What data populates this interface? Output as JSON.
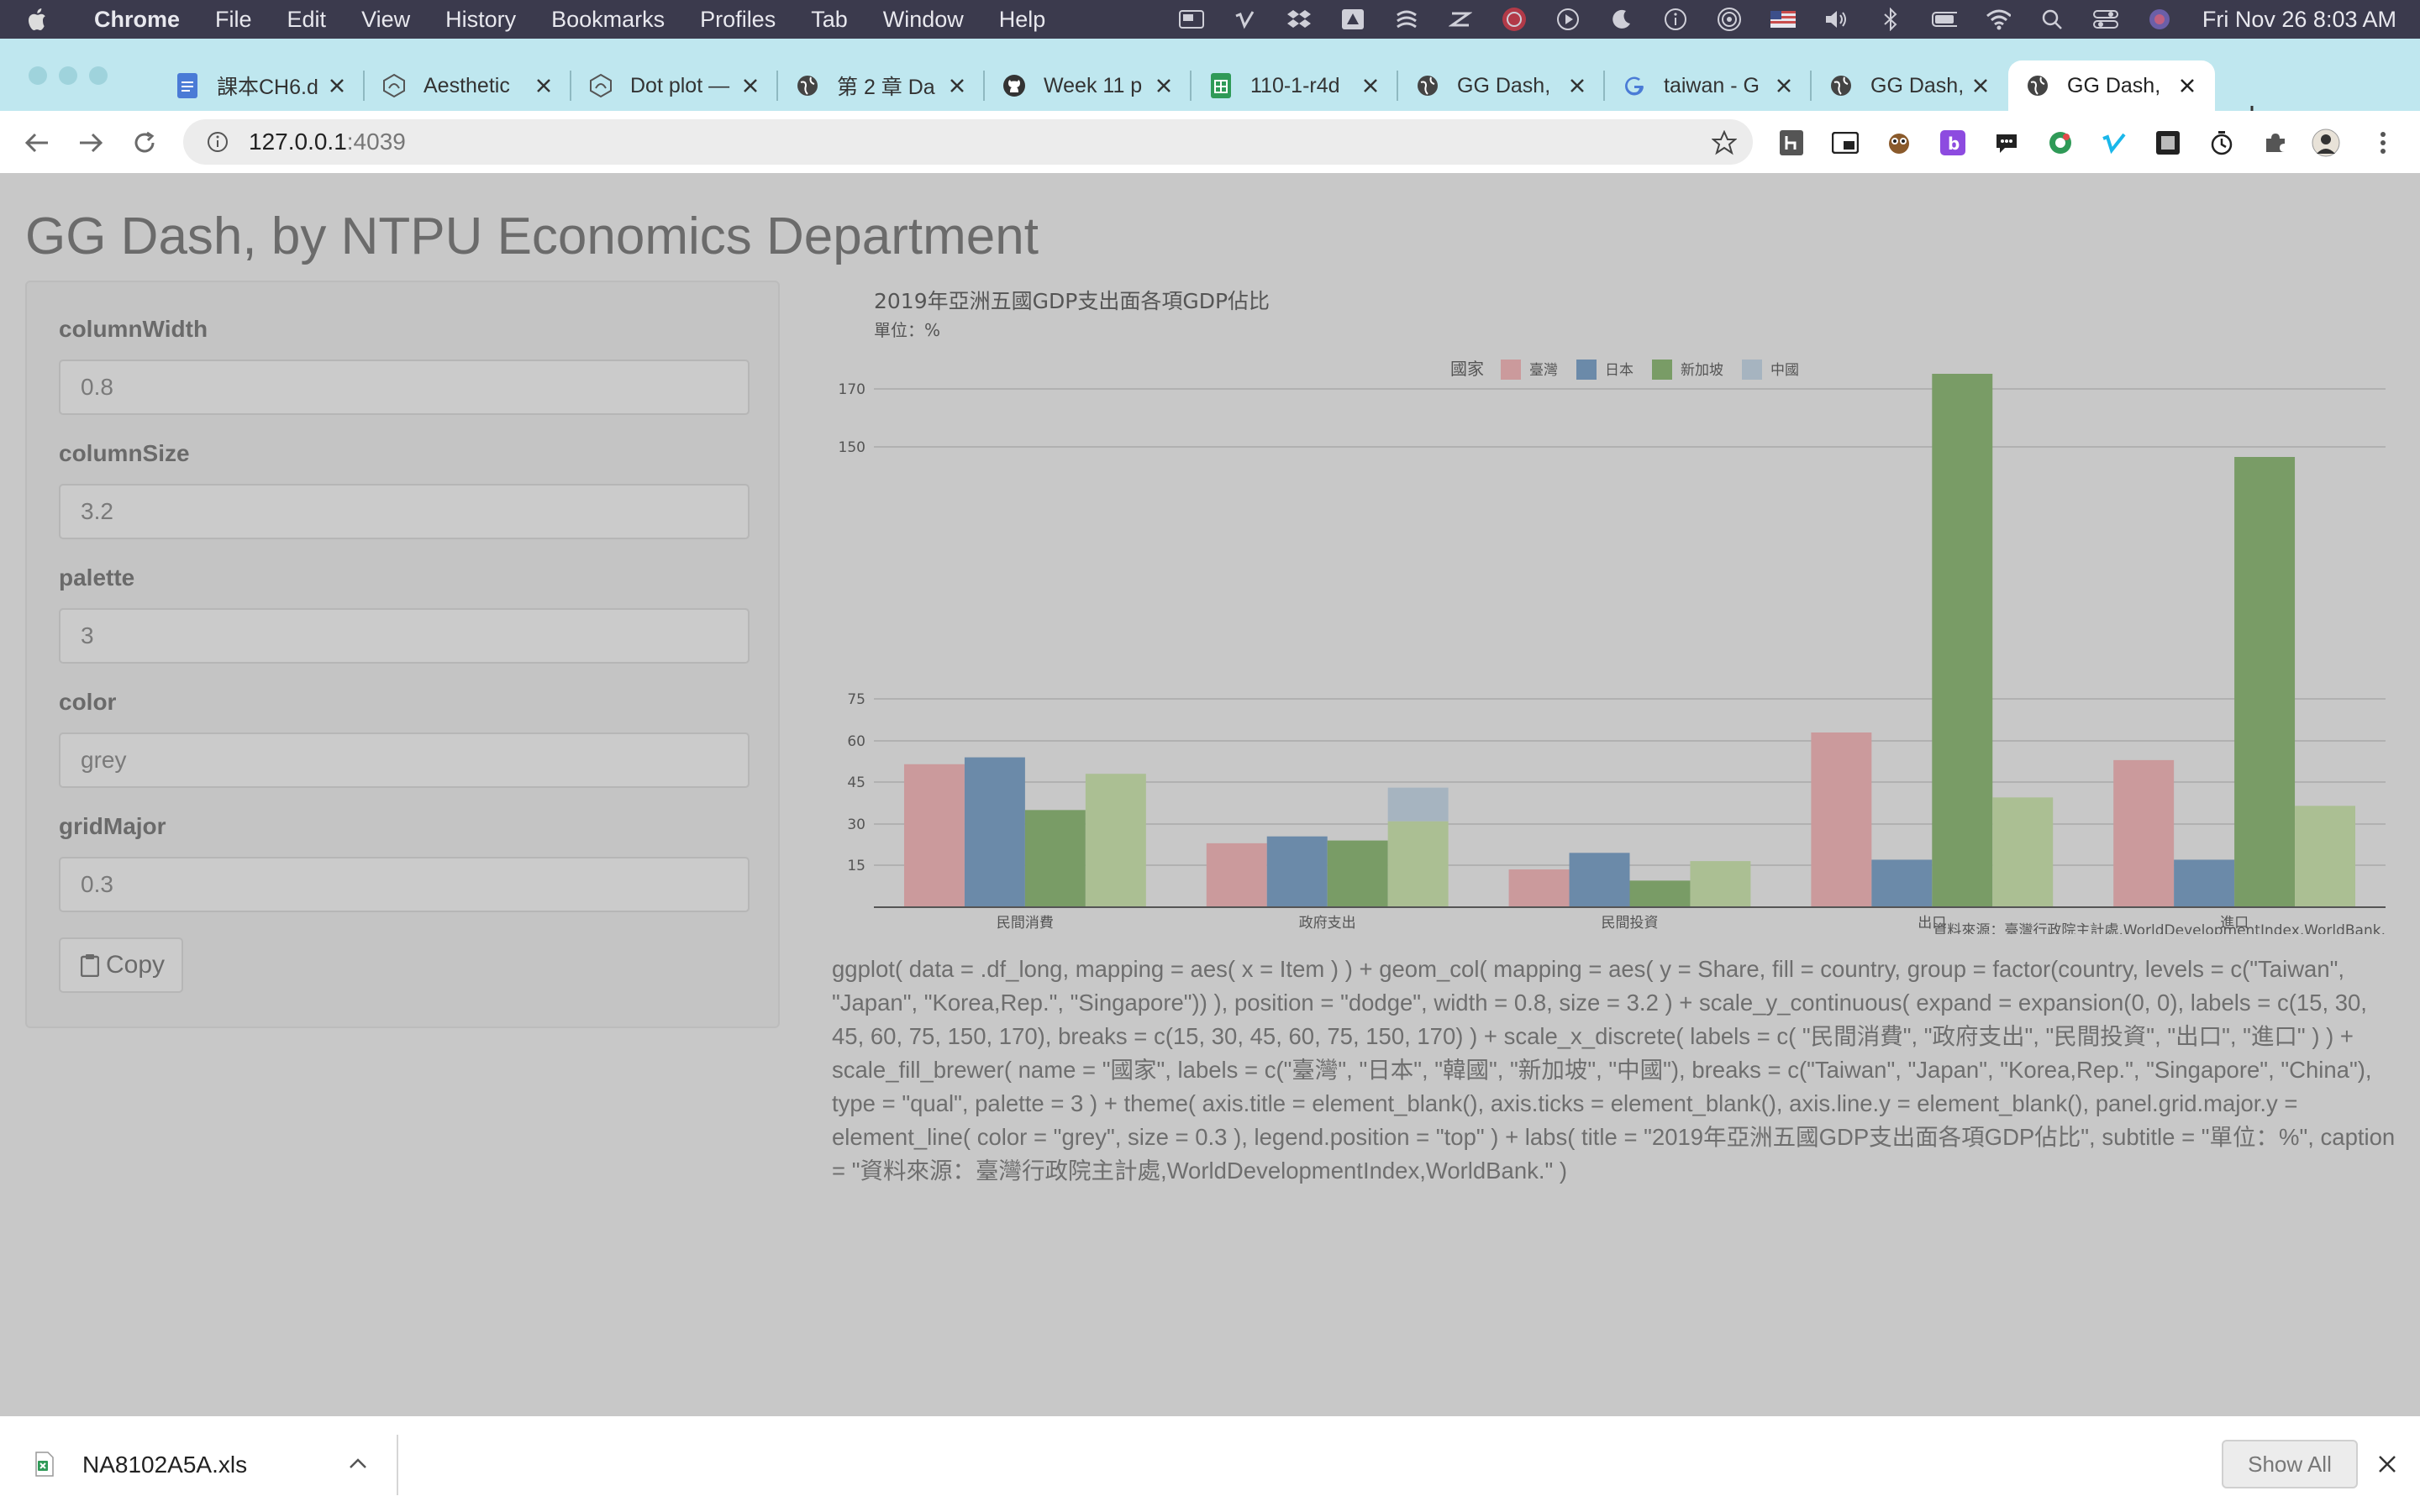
{
  "menubar": {
    "app": "Chrome",
    "items": [
      "File",
      "Edit",
      "View",
      "History",
      "Bookmarks",
      "Profiles",
      "Tab",
      "Window",
      "Help"
    ],
    "clock": "Fri Nov 26  8:03 AM",
    "tray_icons": [
      "window-icon",
      "vimeo-icon",
      "dropbox-icon",
      "drive-icon",
      "app-icon",
      "app-icon",
      "app-icon",
      "play-icon",
      "moon-icon",
      "info-icon",
      "airdrop-icon",
      "flag-icon",
      "volume-icon",
      "bluetooth-icon",
      "battery-icon",
      "wifi-icon",
      "search-icon",
      "control-center-icon",
      "siri-icon"
    ]
  },
  "tabs": [
    {
      "title": "課本CH6.d",
      "icon": "docs-icon"
    },
    {
      "title": "Aesthetic",
      "icon": "ggplot-icon"
    },
    {
      "title": "Dot plot —",
      "icon": "ggplot-icon"
    },
    {
      "title": "第 2 章 Da",
      "icon": "globe-icon"
    },
    {
      "title": "Week 11 p",
      "icon": "github-icon"
    },
    {
      "title": "110-1-r4d",
      "icon": "sheets-icon"
    },
    {
      "title": "GG Dash,",
      "icon": "globe-icon"
    },
    {
      "title": "taiwan - G",
      "icon": "google-icon"
    },
    {
      "title": "GG Dash,",
      "icon": "globe-icon"
    },
    {
      "title": "GG Dash,",
      "icon": "globe-icon"
    }
  ],
  "active_tab": 9,
  "address": {
    "host": "127.0.0.1",
    "port": ":4039"
  },
  "page": {
    "title": "GG Dash, by NTPU Economics Department",
    "fields": [
      {
        "label": "columnWidth",
        "value": "0.8"
      },
      {
        "label": "columnSize",
        "value": "3.2"
      },
      {
        "label": "palette",
        "value": "3"
      },
      {
        "label": "color",
        "value": "grey"
      },
      {
        "label": "gridMajor",
        "value": "0.3"
      }
    ],
    "copy_label": "Copy",
    "code": "ggplot( data = .df_long, mapping = aes( x = Item ) ) + geom_col( mapping = aes( y = Share, fill = country, group = factor(country, levels = c(\"Taiwan\", \"Japan\", \"Korea,Rep.\", \"Singapore\")) ), position = \"dodge\", width = 0.8, size = 3.2 ) + scale_y_continuous( expand = expansion(0, 0), labels = c(15, 30, 45, 60, 75, 150, 170), breaks = c(15, 30, 45, 60, 75, 150, 170) ) + scale_x_discrete( labels = c( \"民間消費\", \"政府支出\", \"民間投資\", \"出口\", \"進口\" ) ) + scale_fill_brewer( name = \"國家\", labels = c(\"臺灣\", \"日本\", \"韓國\", \"新加坡\", \"中國\"), breaks = c(\"Taiwan\", \"Japan\", \"Korea,Rep.\", \"Singapore\", \"China\"), type = \"qual\", palette = 3 ) + theme( axis.title = element_blank(), axis.ticks = element_blank(), axis.line.y = element_blank(), panel.grid.major.y = element_line( color = \"grey\", size = 0.3 ), legend.position = \"top\" ) + labs( title = \"2019年亞洲五國GDP支出面各項GDP佔比\", subtitle = \"單位：%\", caption = \"資料來源：臺灣行政院主計處,WorldDevelopmentIndex,WorldBank.\" )"
  },
  "chart_data": {
    "type": "bar",
    "title": "2019年亞洲五國GDP支出面各項GDP佔比",
    "subtitle": "單位：%",
    "caption": "資料來源：臺灣行政院主計處,WorldDevelopmentIndex,WorldBank.",
    "legend_title": "國家",
    "legend_position": "top",
    "categories": [
      "民間消費",
      "政府支出",
      "民間投資",
      "出口",
      "進口"
    ],
    "y_ticks": [
      15,
      30,
      45,
      60,
      75,
      150,
      170
    ],
    "ylim": [
      0,
      175
    ],
    "grid": true,
    "series": [
      {
        "name": "臺灣",
        "color": "#cb9a9c",
        "values": [
          51.5,
          23,
          13.5,
          63,
          53
        ]
      },
      {
        "name": "日本",
        "color": "#6b8aa9",
        "values": [
          54,
          25.5,
          19.5,
          17,
          17
        ]
      },
      {
        "name": "新加坡",
        "color": "#799c66",
        "values": [
          35,
          24,
          9.5,
          175,
          147
        ]
      },
      {
        "name": "中國",
        "color": "#abbf93",
        "values": [
          48,
          31,
          16.5,
          39.5,
          36.5
        ]
      }
    ],
    "extra_bars": [
      {
        "category": "政府支出",
        "series": "中國",
        "color": "#a6b4c0",
        "base": 31,
        "top": 43
      }
    ],
    "legend_extra": [
      {
        "name": "中國",
        "color": "#a6b4c0"
      }
    ]
  },
  "download": {
    "file_name": "NA8102A5A.xls",
    "show_all": "Show All"
  }
}
